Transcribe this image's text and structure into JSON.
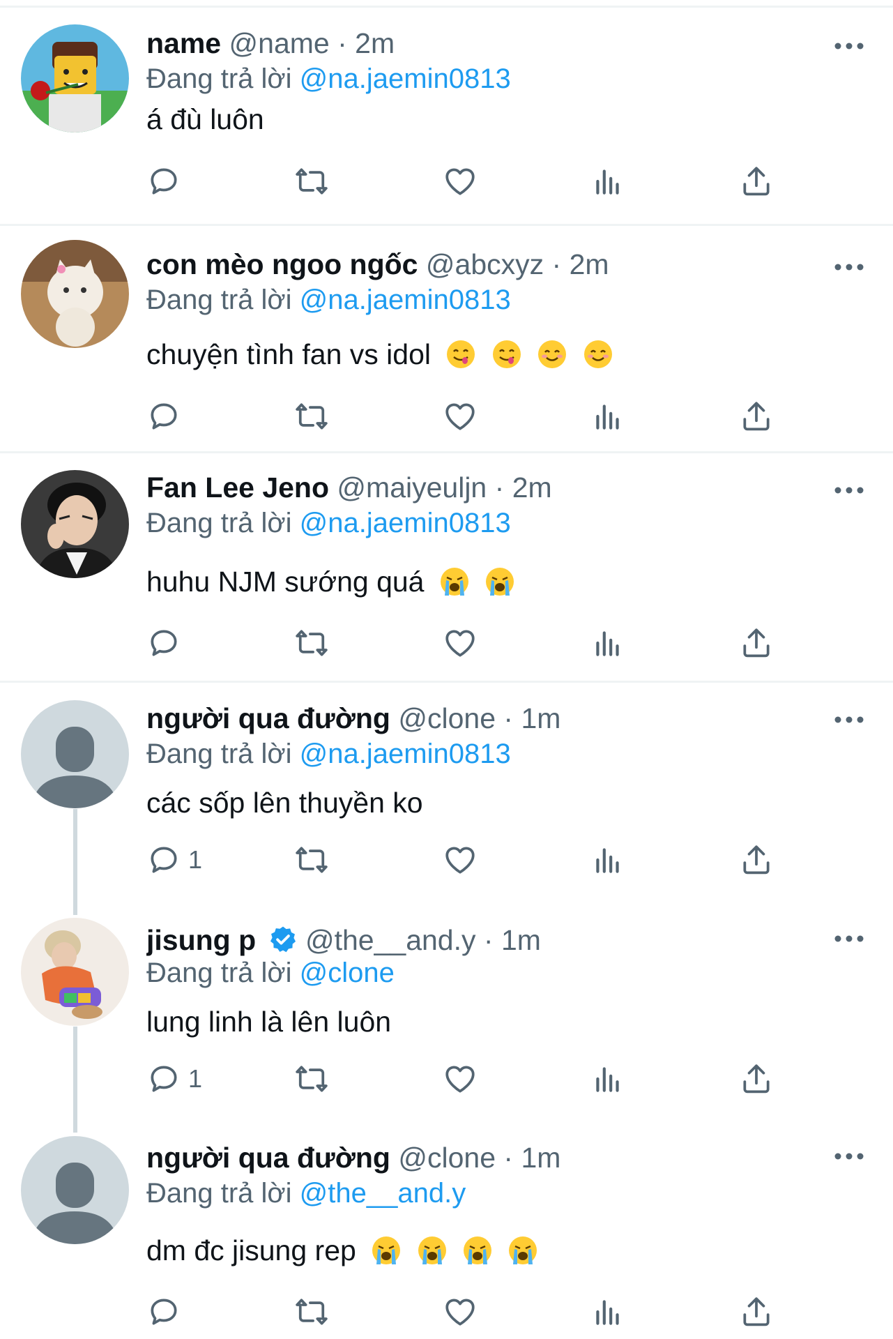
{
  "reply_prefix": "Đang trả lời",
  "tweets": [
    {
      "name": "name",
      "handle": "@name",
      "dot": "·",
      "time": "2m",
      "reply_to": "@na.jaemin0813",
      "text": "á đù luôn",
      "emojis": [],
      "reply_count": "",
      "verified": false
    },
    {
      "name": "con mèo ngoo ngốc",
      "handle": "@abcxyz",
      "dot": "·",
      "time": "2m",
      "reply_to": "@na.jaemin0813",
      "text": "chuyện tình fan vs idol",
      "emojis": [
        "yum-emoji",
        "yum-emoji",
        "blush-emoji",
        "blush-emoji"
      ],
      "reply_count": "",
      "verified": false
    },
    {
      "name": "Fan Lee Jeno",
      "handle": "@maiyeuljn",
      "dot": "·",
      "time": "2m",
      "reply_to": "@na.jaemin0813",
      "text": "huhu NJM sướng quá",
      "emojis": [
        "crying-emoji",
        "crying-emoji"
      ],
      "reply_count": "",
      "verified": false
    },
    {
      "name": "người qua đường",
      "handle": "@clone",
      "dot": "·",
      "time": "1m",
      "reply_to": "@na.jaemin0813",
      "text": "các sốp lên thuyền ko",
      "emojis": [],
      "reply_count": "1",
      "verified": false
    },
    {
      "name": "jisung p",
      "handle": "@the__and.y",
      "dot": "·",
      "time": "1m",
      "reply_to": "@clone",
      "text": "lung linh là lên luôn",
      "emojis": [],
      "reply_count": "1",
      "verified": true
    },
    {
      "name": "người qua đường",
      "handle": "@clone",
      "dot": "·",
      "time": "1m",
      "reply_to": "@the__and.y",
      "text": "dm đc jisung rep",
      "emojis": [
        "crying-emoji",
        "crying-emoji",
        "crying-emoji",
        "crying-emoji"
      ],
      "reply_count": "",
      "verified": false
    }
  ],
  "colors": {
    "accent": "#1d9bf0",
    "secondary_text": "#536471",
    "primary_text": "#0f1419",
    "divider": "#eff3f4",
    "thread_line": "#cfd9de"
  }
}
